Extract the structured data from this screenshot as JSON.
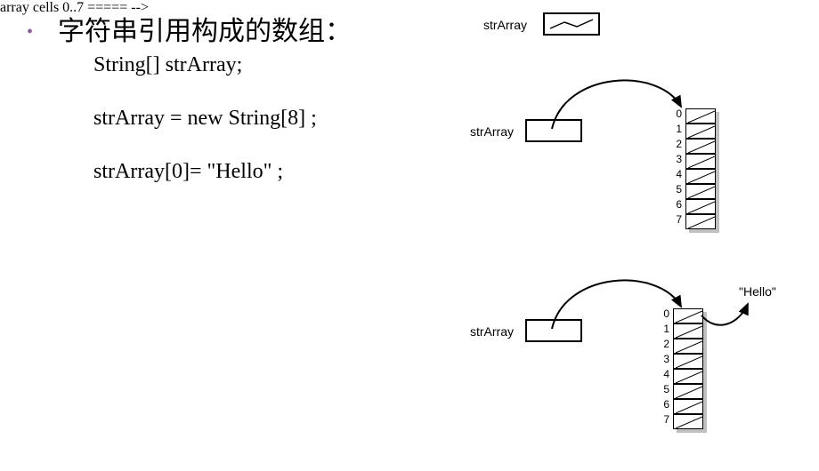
{
  "bullet": "•",
  "heading": "字符串引用构成的数组：",
  "code": {
    "line1": "String[] strArray;",
    "line2": "strArray = new String[8] ;",
    "line3": "strArray[0]= \"Hello\" ;"
  },
  "diagram": {
    "label_top": "strArray",
    "label_mid": "strArray",
    "label_bot": "strArray",
    "indices": [
      "0",
      "1",
      "2",
      "3",
      "4",
      "5",
      "6",
      "7"
    ],
    "hello": "\"Hello\""
  }
}
